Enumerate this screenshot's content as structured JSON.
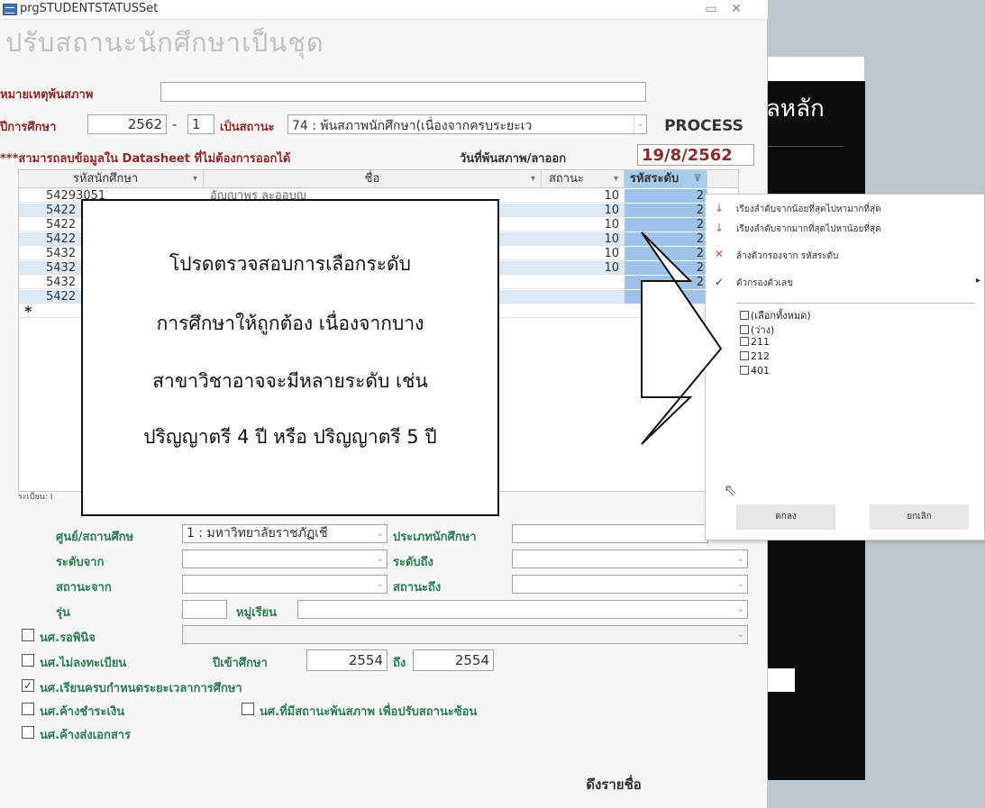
{
  "window": {
    "title": "prgSTUDENTSTATUSSet",
    "minimize": "▭",
    "close": "✕"
  },
  "background": {
    "heading": "ลหลัก"
  },
  "form": {
    "title": "ปรับสถานะนักศึกษาเป็นชุด",
    "reason_label": "หมายเหตุพ้นสภาพ",
    "reason_value": "",
    "year_label": "ปีการศึกษา",
    "year_value": "2562",
    "dash": "-",
    "term_value": "1",
    "status_label": "เป็นสถานะ",
    "status_value": "74 : พ้นสภาพนักศึกษา(เนื่องจากครบระยะเว",
    "process_button": "PROCESS",
    "note": "***สามารถลบข้อมูลใน Datasheet ที่ไม่ต้องการออกได้",
    "date_label": "วันที่พ้นสภาพ/ลาออก",
    "date_value": "19/8/2562"
  },
  "sheet": {
    "columns": [
      "รหัสนักศึกษา",
      "ชื่อ",
      "สถานะ",
      "รหัสระดับ"
    ],
    "rows": [
      {
        "id": "54293051",
        "name": "อัญญาพร ละออบุญ",
        "status": "10",
        "level": "2"
      },
      {
        "id": "5422",
        "name": "",
        "status": "10",
        "level": "2"
      },
      {
        "id": "5422",
        "name": "",
        "status": "10",
        "level": "2"
      },
      {
        "id": "5422",
        "name": "",
        "status": "10",
        "level": "2"
      },
      {
        "id": "5432",
        "name": "",
        "status": "10",
        "level": "2"
      },
      {
        "id": "5432",
        "name": "",
        "status": "10",
        "level": "2"
      },
      {
        "id": "5432",
        "name": "",
        "status": "",
        "level": "2"
      },
      {
        "id": "5422",
        "name": "",
        "status": "",
        "level": ""
      }
    ],
    "new_row_marker": "*",
    "record_nav": "ระเบียน: I"
  },
  "filters": {
    "center_label": "ศูนย์/สถานศึกษ",
    "center_value": "1 : มหาวิทยาลัยราชภัฏเชี",
    "student_type_label": "ประเภทนักศึกษา",
    "student_type_value": "",
    "level_from_label": "ระดับจาก",
    "level_to_label": "ระดับถึง",
    "status_from_label": "สถานะจาก",
    "status_to_label": "สถานะถึง",
    "gen_label": "รุ่น",
    "group_label": "หมู่เรียน",
    "chk_wait_label": "นศ.รอพินิจ",
    "chk_no_register_label": "นศ.ไม่ลงทะเบียน",
    "year_enter_label": "ปีเข้าศึกษา",
    "year_from": "2554",
    "year_to_label": "ถึง",
    "year_to": "2554",
    "chk_complete_label": "นศ.เรียนครบกำหนดระยะเวลาการศึกษา",
    "chk_debt_label": "นศ.ค้างชำระเงิน",
    "chk_has_status_label": "นศ.ที่มีสถานะพ้นสภาพ เพื่อปรับสถานะซ้อน",
    "chk_docs_label": "นศ.ค้างส่งเอกสาร",
    "get_names_button": "ดึงรายชื่อ"
  },
  "menu": {
    "sort_asc": "เรียงลำดับจากน้อยที่สุดไปหามากที่สุด",
    "sort_desc": "เรียงลำดับจากมากที่สุดไปหาน้อยที่สุด",
    "clear_filter": "ล้างตัวกรองจาก รหัสระดับ",
    "number_filters": "ตัวกรองตัวเลข",
    "list": [
      "(เลือกทั้งหมด)",
      "(ว่าง)",
      "211",
      "212",
      "401"
    ],
    "ok": "ตกลง",
    "cancel": "ยกเลิก"
  },
  "callout": {
    "lines": [
      "โปรดตรวจสอบการเลือกระดับ",
      "การศึกษาให้ถูกต้อง เนื่องจากบาง",
      "สาขาวิชาอาจจะมีหลายระดับ เช่น",
      "ปริญญาตรี 4 ปี หรือ ปริญญาตรี 5 ปี"
    ]
  },
  "colors": {
    "label_red": "#8e2a2a",
    "label_green": "#2e7d57",
    "selected_col": "#a8cdea",
    "alt_row": "#dbe8f6"
  }
}
